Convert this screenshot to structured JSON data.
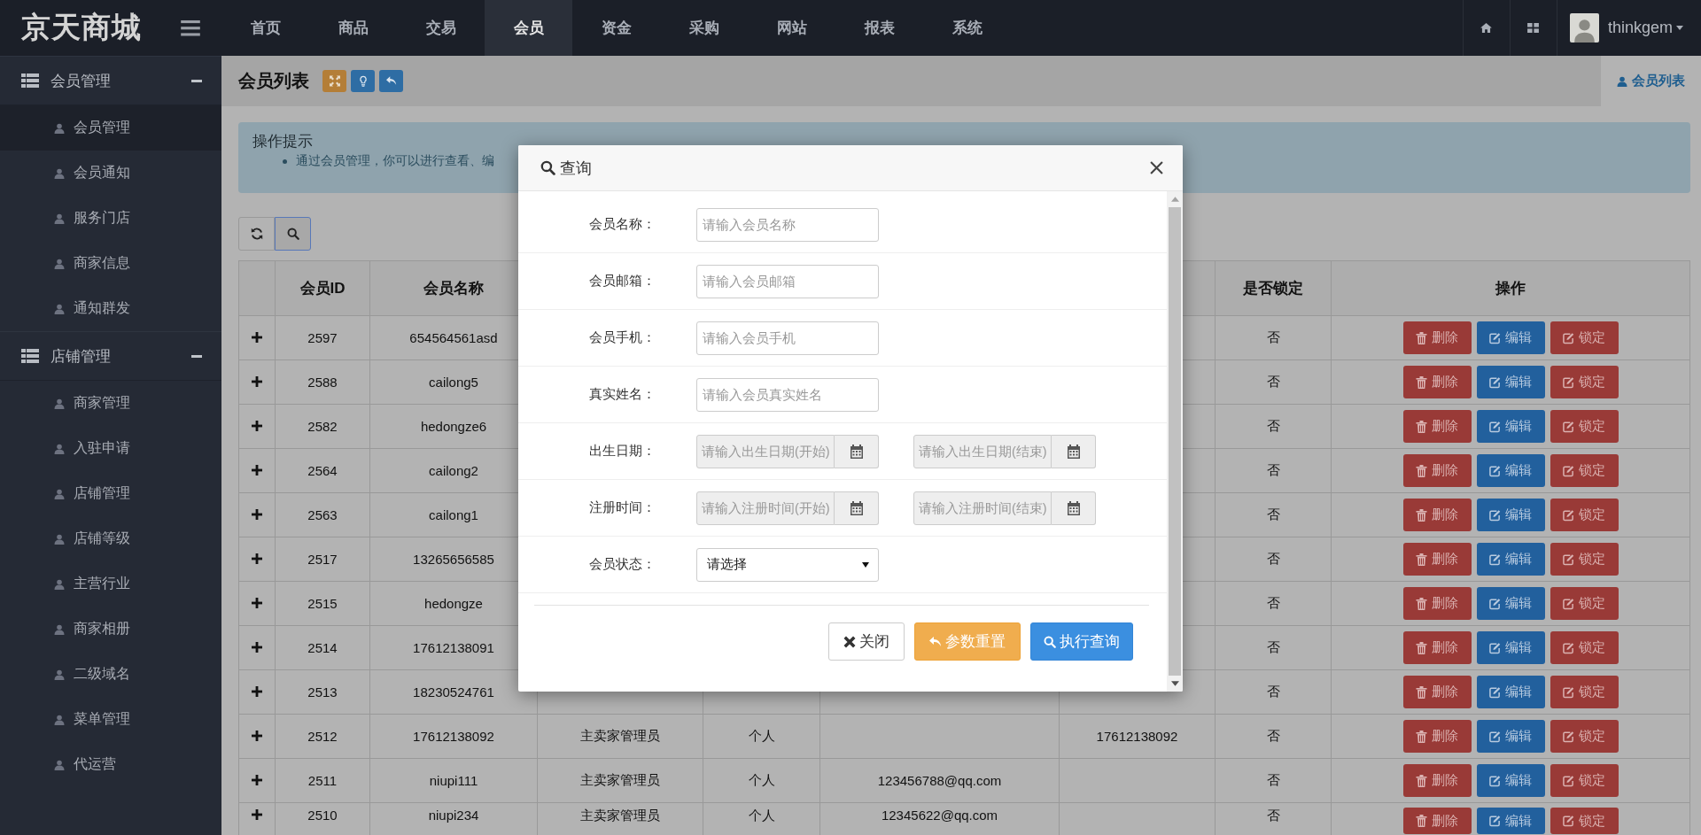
{
  "app": {
    "logo": "京天商城"
  },
  "nav": [
    {
      "label": "首页",
      "selected": false
    },
    {
      "label": "商品",
      "selected": false
    },
    {
      "label": "交易",
      "selected": false
    },
    {
      "label": "会员",
      "selected": true
    },
    {
      "label": "资金",
      "selected": false
    },
    {
      "label": "采购",
      "selected": false
    },
    {
      "label": "网站",
      "selected": false
    },
    {
      "label": "报表",
      "selected": false
    },
    {
      "label": "系统",
      "selected": false
    }
  ],
  "user": {
    "name": "thinkgem"
  },
  "sidebar": {
    "groups": [
      {
        "label": "会员管理",
        "expanded": true,
        "children": [
          {
            "label": "会员管理",
            "selected": true
          },
          {
            "label": "会员通知",
            "selected": false
          },
          {
            "label": "服务门店",
            "selected": false
          },
          {
            "label": "商家信息",
            "selected": false
          },
          {
            "label": "通知群发",
            "selected": false
          }
        ]
      },
      {
        "label": "店铺管理",
        "expanded": true,
        "children": [
          {
            "label": "商家管理",
            "selected": false
          },
          {
            "label": "入驻申请",
            "selected": false
          },
          {
            "label": "店铺管理",
            "selected": false
          },
          {
            "label": "店铺等级",
            "selected": false
          },
          {
            "label": "主营行业",
            "selected": false
          },
          {
            "label": "商家相册",
            "selected": false
          },
          {
            "label": "二级域名",
            "selected": false
          },
          {
            "label": "菜单管理",
            "selected": false
          },
          {
            "label": "代运营",
            "selected": false
          }
        ]
      }
    ]
  },
  "page": {
    "title": "会员列表",
    "tab": "会员列表"
  },
  "tip": {
    "title": "操作提示",
    "items": [
      "通过会员管理，你可以进行查看、编"
    ]
  },
  "table": {
    "columns": [
      "会员ID",
      "会员名称",
      "是否锁定",
      "操作"
    ],
    "rows": [
      {
        "id": "2597",
        "name": "654564561asd",
        "locked": "否",
        "actions": [
          {
            "kind": "delete",
            "label": "删除"
          },
          {
            "kind": "edit",
            "label": "编辑"
          },
          {
            "kind": "lock",
            "label": "锁定"
          }
        ]
      },
      {
        "id": "2588",
        "name": "cailong5",
        "locked": "否",
        "actions": [
          {
            "kind": "delete",
            "label": "删除"
          },
          {
            "kind": "edit",
            "label": "编辑"
          },
          {
            "kind": "lock",
            "label": "锁定"
          }
        ]
      },
      {
        "id": "2582",
        "name": "hedongze6",
        "locked": "否",
        "actions": [
          {
            "kind": "delete",
            "label": "删除"
          },
          {
            "kind": "edit",
            "label": "编辑"
          },
          {
            "kind": "lock",
            "label": "锁定"
          }
        ]
      },
      {
        "id": "2564",
        "name": "cailong2",
        "locked": "否",
        "actions": [
          {
            "kind": "delete",
            "label": "删除"
          },
          {
            "kind": "edit",
            "label": "编辑"
          },
          {
            "kind": "lock",
            "label": "锁定"
          }
        ]
      },
      {
        "id": "2563",
        "name": "cailong1",
        "locked": "否",
        "actions": [
          {
            "kind": "delete",
            "label": "删除"
          },
          {
            "kind": "edit",
            "label": "编辑"
          },
          {
            "kind": "lock",
            "label": "锁定"
          }
        ]
      },
      {
        "id": "2517",
        "name": "13265656585",
        "locked": "否",
        "actions": [
          {
            "kind": "delete",
            "label": "删除"
          },
          {
            "kind": "edit",
            "label": "编辑"
          },
          {
            "kind": "lock",
            "label": "锁定"
          }
        ]
      },
      {
        "id": "2515",
        "name": "hedongze",
        "locked": "否",
        "actions": [
          {
            "kind": "delete",
            "label": "删除"
          },
          {
            "kind": "edit",
            "label": "编辑"
          },
          {
            "kind": "lock",
            "label": "锁定"
          }
        ]
      },
      {
        "id": "2514",
        "name": "17612138091",
        "locked": "否",
        "actions": [
          {
            "kind": "delete",
            "label": "删除"
          },
          {
            "kind": "edit",
            "label": "编辑"
          },
          {
            "kind": "lock",
            "label": "锁定"
          }
        ]
      },
      {
        "id": "2513",
        "name": "18230524761",
        "locked": "否",
        "actions": [
          {
            "kind": "delete",
            "label": "删除"
          },
          {
            "kind": "edit",
            "label": "编辑"
          },
          {
            "kind": "lock",
            "label": "锁定"
          }
        ]
      },
      {
        "id": "2512",
        "name": "17612138092",
        "column_4": "主卖家管理员",
        "column_5": "个人",
        "column_7": "17612138092",
        "locked": "否",
        "actions": [
          {
            "kind": "delete",
            "label": "删除"
          },
          {
            "kind": "edit",
            "label": "编辑"
          },
          {
            "kind": "lock",
            "label": "锁定"
          }
        ]
      },
      {
        "id": "2511",
        "name": "niupi111",
        "column_4": "主卖家管理员",
        "column_5": "个人",
        "column_6": "123456788@qq.com",
        "locked": "否",
        "actions": [
          {
            "kind": "delete",
            "label": "删除"
          },
          {
            "kind": "edit",
            "label": "编辑"
          },
          {
            "kind": "lock",
            "label": "锁定"
          }
        ]
      },
      {
        "id": "2510",
        "name": "niupi234",
        "column_4": "主卖家管理员",
        "column_5": "个人",
        "column_6": "12345622@qq.com",
        "locked": "否",
        "actions": [
          {
            "kind": "delete",
            "label": "删除"
          },
          {
            "kind": "edit",
            "label": "编辑"
          },
          {
            "kind": "lock",
            "label": "锁定"
          }
        ]
      }
    ]
  },
  "modal": {
    "title": "查询",
    "fields": [
      {
        "kind": "text",
        "label": "会员名称：",
        "placeholder": "请输入会员名称"
      },
      {
        "kind": "text",
        "label": "会员邮箱：",
        "placeholder": "请输入会员邮箱"
      },
      {
        "kind": "text",
        "label": "会员手机：",
        "placeholder": "请输入会员手机"
      },
      {
        "kind": "text",
        "label": "真实姓名：",
        "placeholder": "请输入会员真实姓名"
      },
      {
        "kind": "daterange",
        "label": "出生日期：",
        "placeholders": [
          "请输入出生日期(开始)",
          "请输入出生日期(结束)"
        ]
      },
      {
        "kind": "daterange",
        "label": "注册时间：",
        "placeholders": [
          "请输入注册时间(开始)",
          "请输入注册时间(结束)"
        ]
      },
      {
        "kind": "select",
        "label": "会员状态：",
        "value": "请选择"
      }
    ],
    "buttons": [
      {
        "kind": "close",
        "label": "关闭"
      },
      {
        "kind": "reset",
        "label": "参数重置"
      },
      {
        "kind": "search",
        "label": "执行查询"
      }
    ]
  }
}
